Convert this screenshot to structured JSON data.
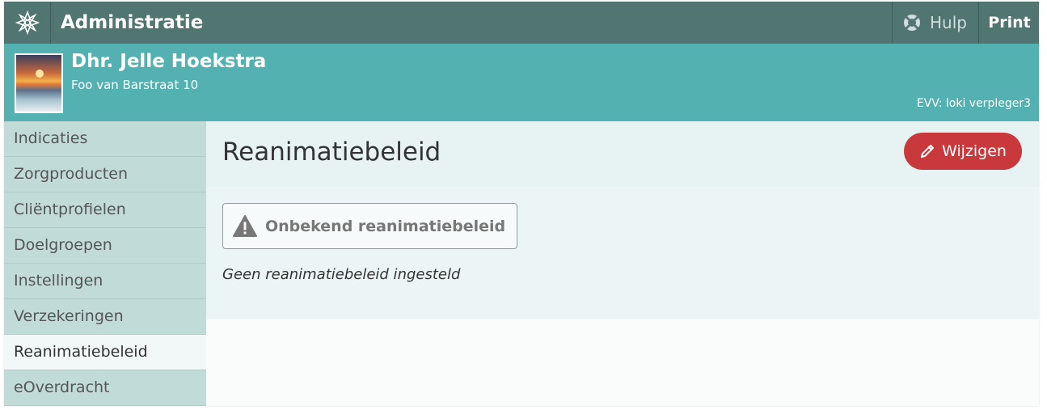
{
  "header": {
    "title": "Administratie",
    "logo_icon": "flower-logo-icon",
    "help_label": "Hulp",
    "help_icon": "lifebuoy-icon",
    "print_label": "Print"
  },
  "patient": {
    "name": "Dhr. Jelle Hoekstra",
    "address": "Foo van Barstraat 10",
    "evv": "EVV: loki verpleger3"
  },
  "sidebar": {
    "items": [
      {
        "label": "Indicaties"
      },
      {
        "label": "Zorgproducten"
      },
      {
        "label": "Cliëntprofielen"
      },
      {
        "label": "Doelgroepen"
      },
      {
        "label": "Instellingen"
      },
      {
        "label": "Verzekeringen"
      },
      {
        "label": "Reanimatiebeleid",
        "active": true
      },
      {
        "label": "eOverdracht"
      }
    ]
  },
  "main": {
    "title": "Reanimatiebeleid",
    "edit_label": "Wijzigen",
    "edit_icon": "pencil-icon",
    "status_label": "Onbekend reanimatiebeleid",
    "status_icon": "warning-icon",
    "note": "Geen reanimatiebeleid ingesteld"
  },
  "colors": {
    "topbar": "#517672",
    "banner": "#53b1b1",
    "sidebar": "#c1dbd8",
    "accent_button": "#c9393b"
  }
}
